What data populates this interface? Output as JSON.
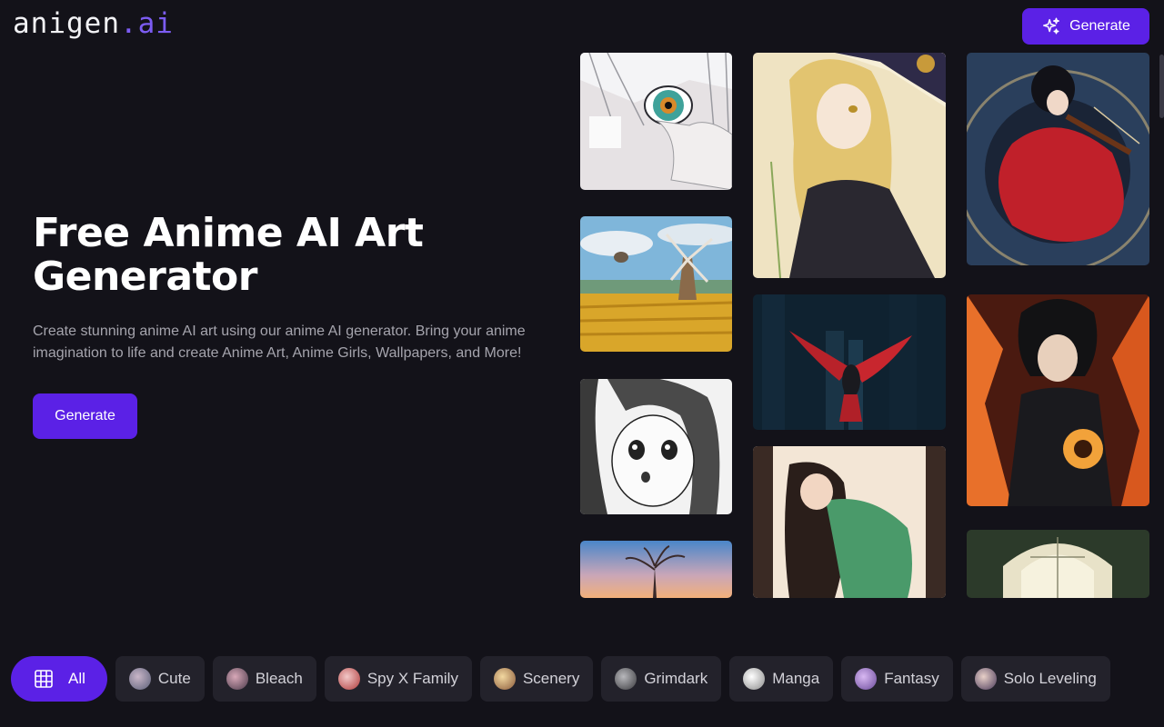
{
  "header": {
    "logo_main": "anigen",
    "logo_accent": ".ai",
    "generate_label": "Generate"
  },
  "hero": {
    "title": "Free Anime AI Art Generator",
    "description": "Create stunning anime AI art using our anime AI generator. Bring your anime imagination to life and create Anime Art, Anime Girls, Wallpapers, and More!",
    "generate_label": "Generate"
  },
  "gallery": {
    "images": [
      "anime-eye-closeup",
      "windmill-field-scenery",
      "manga-girl-monochrome",
      "sunset-tree-scenery",
      "blonde-witch-girl",
      "red-crow-city",
      "girl-green-dress-window",
      "violin-girl-red-dress",
      "fire-magic-boy",
      "cathedral-arches"
    ]
  },
  "categories": [
    {
      "label": "All",
      "icon": "grid-icon",
      "active": true
    },
    {
      "label": "Cute",
      "icon": "cute-thumb",
      "color": "#6a6f86"
    },
    {
      "label": "Bleach",
      "icon": "bleach-thumb",
      "color": "#7a5a6a"
    },
    {
      "label": "Spy X Family",
      "icon": "spy-x-family-thumb",
      "color": "#b04848"
    },
    {
      "label": "Scenery",
      "icon": "scenery-thumb",
      "color": "#c89a5a"
    },
    {
      "label": "Grimdark",
      "icon": "grimdark-thumb",
      "color": "#5a5a5e"
    },
    {
      "label": "Manga",
      "icon": "manga-thumb",
      "color": "#d8d8d8"
    },
    {
      "label": "Fantasy",
      "icon": "fantasy-thumb",
      "color": "#8a64b8"
    },
    {
      "label": "Solo Leveling",
      "icon": "solo-leveling-thumb",
      "color": "#6a5a78"
    }
  ],
  "colors": {
    "background": "#131219",
    "accent": "#5b21e6",
    "logo_accent": "#7c5cf2",
    "chip_bg": "#23222b"
  }
}
